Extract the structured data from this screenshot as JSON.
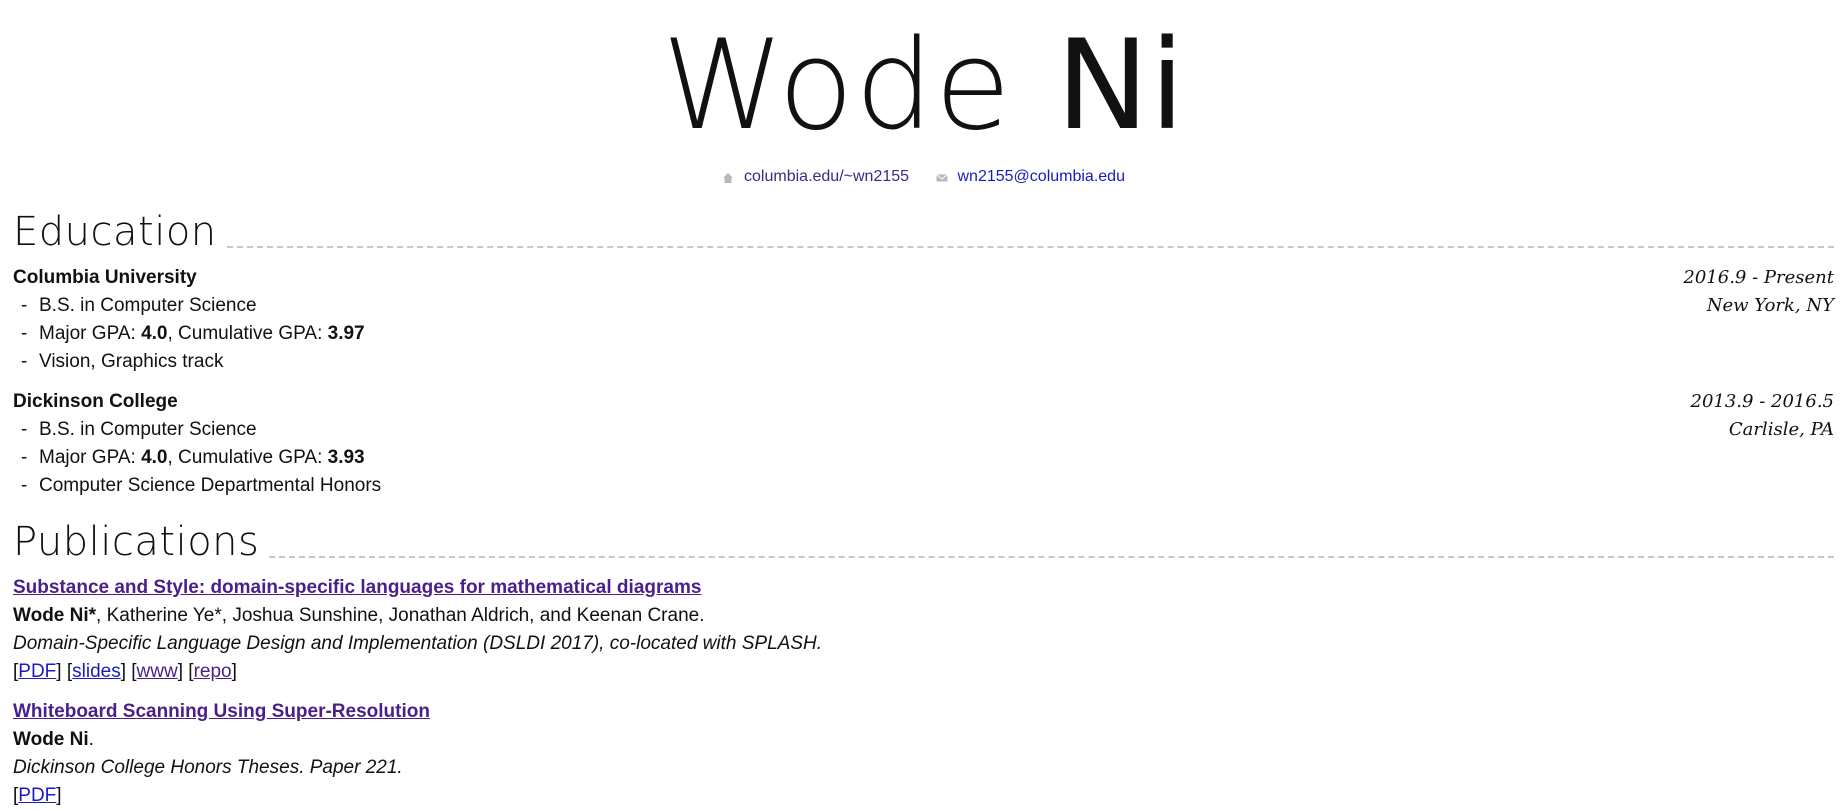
{
  "header": {
    "first_name": "Wode",
    "last_name": "Ni",
    "website": "columbia.edu/~wn2155",
    "email": "wn2155@columbia.edu"
  },
  "education": {
    "heading": "Education",
    "entries": [
      {
        "institution": "Columbia University",
        "dates": "2016.9 - Present",
        "location": "New York, NY",
        "degree": "B.S. in Computer Science",
        "gpa_major_label": "Major GPA: ",
        "gpa_major": "4.0",
        "gpa_cum_label": ", Cumulative GPA: ",
        "gpa_cum": "3.97",
        "note": "Vision, Graphics track"
      },
      {
        "institution": "Dickinson College",
        "dates": "2013.9 - 2016.5",
        "location": "Carlisle, PA",
        "degree": "B.S. in Computer Science",
        "gpa_major_label": "Major GPA: ",
        "gpa_major": "4.0",
        "gpa_cum_label": ", Cumulative GPA: ",
        "gpa_cum": "3.93",
        "note": "Computer Science Departmental Honors"
      }
    ]
  },
  "publications": {
    "heading": "Publications",
    "items": [
      {
        "title": "Substance and Style: domain-specific languages for mathematical diagrams",
        "author_bold": "Wode Ni*",
        "authors_rest": ", Katherine Ye*, Joshua Sunshine, Jonathan Aldrich, and Keenan Crane.",
        "venue": "Domain-Specific Language Design and Implementation (DSLDI 2017), co-located with SPLASH.",
        "links": [
          "PDF",
          "slides",
          "www",
          "repo"
        ]
      },
      {
        "title": "Whiteboard Scanning Using Super-Resolution",
        "author_bold": "Wode Ni",
        "authors_rest": ".",
        "venue": "Dickinson College Honors Theses. Paper 221.",
        "links": [
          "PDF"
        ]
      }
    ]
  },
  "icons": {
    "website": "home-icon",
    "email": "mail-icon"
  }
}
